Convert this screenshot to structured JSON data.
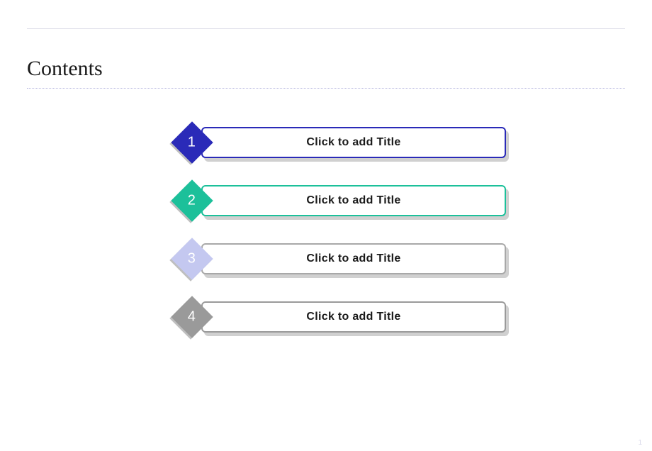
{
  "title": "Contents",
  "items": [
    {
      "num": "1",
      "label": "Click to add Title",
      "diamond_fill": "#2a2ab8",
      "border_color": "#2a2ab8"
    },
    {
      "num": "2",
      "label": "Click to add Title",
      "diamond_fill": "#1cc09a",
      "border_color": "#1cc09a"
    },
    {
      "num": "3",
      "label": "Click to add Title",
      "diamond_fill": "#c4c8f0",
      "border_color": "#a8a8a8"
    },
    {
      "num": "4",
      "label": "Click to add Title",
      "diamond_fill": "#9a9a9a",
      "border_color": "#9a9a9a"
    }
  ],
  "page_number": "1"
}
